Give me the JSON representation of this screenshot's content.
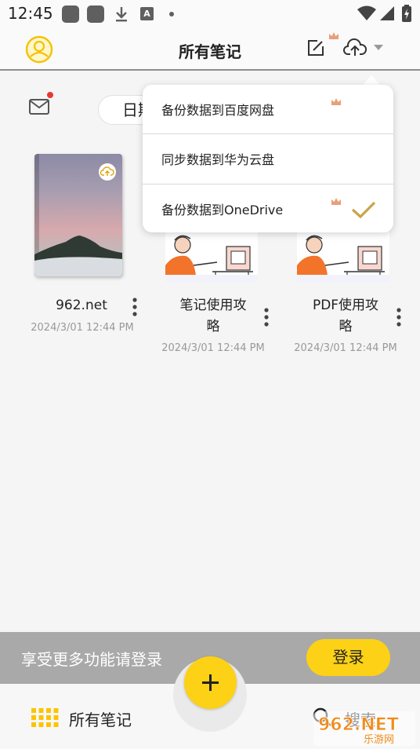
{
  "status_bar": {
    "time": "12:45"
  },
  "header": {
    "title": "所有笔记"
  },
  "toolbar": {
    "sort_label": "日期"
  },
  "notes": [
    {
      "title": "962.net",
      "date": "2024/3/01 12:44 PM"
    },
    {
      "title_line1": "笔记使用攻",
      "title_line2": "略",
      "date": "2024/3/01 12:44 PM"
    },
    {
      "title_line1": "PDF使用攻",
      "title_line2": "略",
      "date": "2024/3/01 12:44 PM"
    }
  ],
  "menu": {
    "items": [
      {
        "label": "备份数据到百度网盘",
        "premium": true,
        "checked": false
      },
      {
        "label": "同步数据到华为云盘",
        "premium": false,
        "checked": false
      },
      {
        "label": "备份数据到OneDrive",
        "premium": true,
        "checked": true
      }
    ]
  },
  "login_bar": {
    "text": "享受更多功能请登录",
    "button": "登录"
  },
  "bottom_nav": {
    "all_notes_label": "所有笔记",
    "search_label": "搜索"
  },
  "watermark": {
    "text_top": "962.NET",
    "text_bottom": "乐游网"
  },
  "colors": {
    "accent": "#fcd116",
    "badge": "#e53935",
    "crown": "#e8a07a",
    "check": "#c9a548"
  },
  "icons": {
    "avatar": "user-circle-icon",
    "edit": "edit-note-icon",
    "cloud": "cloud-upload-icon",
    "mail": "mail-icon",
    "more": "more-vertical-icon",
    "grid": "grid-icon",
    "search": "search-icon",
    "plus": "plus-icon",
    "check": "check-icon",
    "crown": "crown-icon"
  }
}
